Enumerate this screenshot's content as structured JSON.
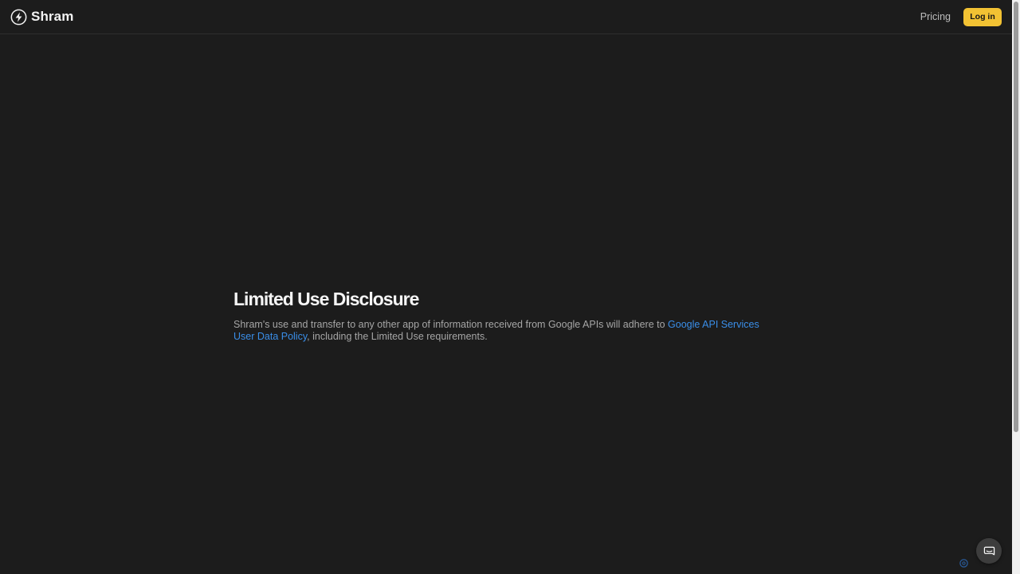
{
  "header": {
    "brand_name": "Shram",
    "brand_icon": "lightning-circle-icon",
    "nav": {
      "pricing_label": "Pricing",
      "login_label": "Log in"
    }
  },
  "main": {
    "title": "Limited Use Disclosure",
    "text_before_link": "Shram's use and transfer to any other app of information received from Google APIs will adhere to ",
    "link_text": "Google API Services User Data Policy",
    "text_after_link": ", including the Limited Use requirements."
  },
  "widgets": {
    "chat_icon": "chat-bubble-icon",
    "corner_icon": "gear-icon"
  },
  "colors": {
    "background": "#1c1c1c",
    "accent": "#f2c233",
    "link": "#3a8ee8"
  }
}
